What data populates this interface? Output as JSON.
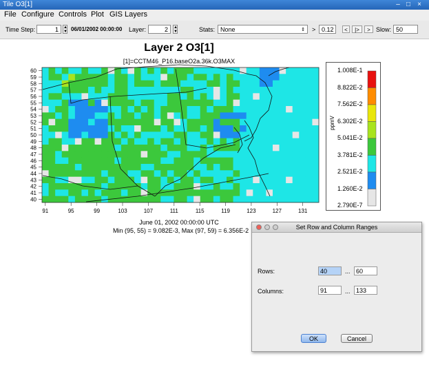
{
  "window": {
    "title": "Tile O3[1]"
  },
  "menu": [
    "File",
    "Configure",
    "Controls",
    "Plot",
    "GIS Layers"
  ],
  "toolbar": {
    "time_step_label": "Time Step:",
    "time_step_value": "1",
    "datetime": "06/01/2002 00:00:00",
    "layer_label": "Layer:",
    "layer_value": "2",
    "stats_label": "Stats:",
    "stats_value": "None",
    "threshold_op": ">",
    "threshold_value": "0.12",
    "nav_buttons": [
      "<",
      "|>",
      ">"
    ],
    "slow_label": "Slow:",
    "slow_value": "50"
  },
  "plot": {
    "title": "Layer 2 O3[1]",
    "subtitle": "[1]=CCTM46_P16.baseO2a.36k.O3MAX",
    "x_ticks": [
      "91",
      "95",
      "99",
      "103",
      "107",
      "111",
      "115",
      "119",
      "123",
      "127",
      "131"
    ],
    "y_ticks": [
      "60",
      "59",
      "58",
      "57",
      "56",
      "55",
      "54",
      "53",
      "52",
      "51",
      "50",
      "49",
      "48",
      "47",
      "46",
      "45",
      "44",
      "43",
      "42",
      "41",
      "40"
    ],
    "date_caption": "June 01, 2002 00:00:00 UTC",
    "minmax_caption": "Min (95, 55) = 9.082E-3, Max (97, 59) = 6.356E-2"
  },
  "legend": {
    "unit": "ppmV",
    "labels": [
      "1.008E-1",
      "8.822E-2",
      "7.562E-2",
      "6.302E-2",
      "5.041E-2",
      "3.781E-2",
      "2.521E-2",
      "1.260E-2",
      "2.790E-7"
    ],
    "colors": [
      "#e8110f",
      "#ff8c00",
      "#e9e60a",
      "#a9e41e",
      "#3cc83c",
      "#1ee6e6",
      "#1e8cf0",
      "#e6e6e6"
    ]
  },
  "dialog": {
    "title": "Set Row and Column Ranges",
    "rows_label": "Rows:",
    "rows_from": "40",
    "rows_to": "60",
    "cols_label": "Columns:",
    "cols_from": "91",
    "cols_to": "133",
    "range_sep": "...",
    "ok_label": "OK",
    "cancel_label": "Cancel"
  }
}
